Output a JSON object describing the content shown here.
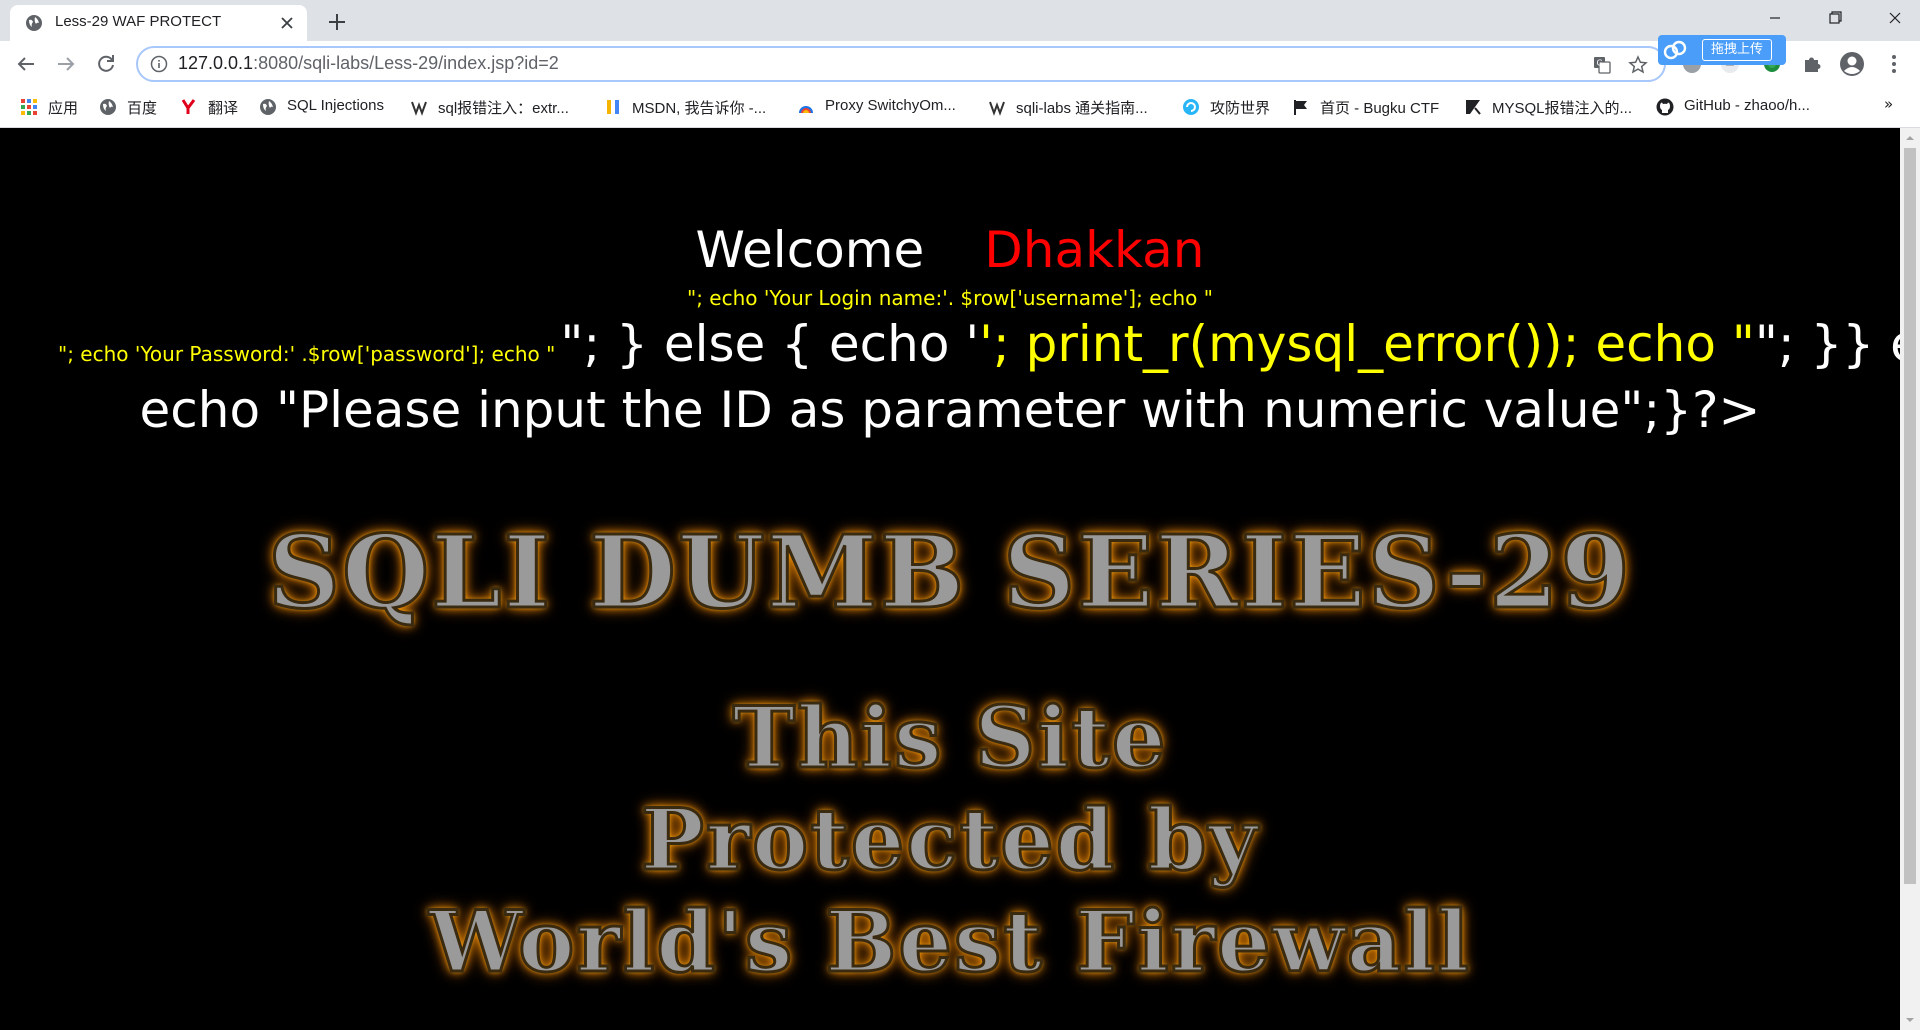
{
  "browser": {
    "tab_title": "Less-29 WAF PROTECT",
    "url_host": "127.0.0.1",
    "url_path": ":8080/sqli-labs/Less-29/index.jsp?id=2",
    "upload_badge_label": "拖拽上传",
    "bookmarks": [
      {
        "label": "应用",
        "icon": "apps-grid-icon"
      },
      {
        "label": "百度",
        "icon": "globe-icon"
      },
      {
        "label": "翻译",
        "icon": "youdao-icon"
      },
      {
        "label": "SQL Injections",
        "icon": "globe-icon"
      },
      {
        "label": "sql报错注入：extr...",
        "icon": "bookmark-site-icon"
      },
      {
        "label": "MSDN, 我告诉你 -...",
        "icon": "msdn-icon"
      },
      {
        "label": "Proxy SwitchyOm...",
        "icon": "switchyomega-icon"
      },
      {
        "label": "sqli-labs 通关指南...",
        "icon": "bookmark-site-icon"
      },
      {
        "label": "攻防世界",
        "icon": "adworld-icon"
      },
      {
        "label": "首页 - Bugku CTF",
        "icon": "flag-icon"
      },
      {
        "label": "MYSQL报错注入的...",
        "icon": "bookmark-site-icon"
      },
      {
        "label": "GitHub - zhaoo/h...",
        "icon": "github-icon"
      }
    ],
    "bookmarks_overflow": "»"
  },
  "page": {
    "welcome": "Welcome",
    "username": "Dhakkan",
    "login_line": "\"; echo 'Your Login name:'. $row['username']; echo \"",
    "password_line": "\"; echo 'Your Password:' .$row['password']; echo \"",
    "code_part1": "\"; } else { echo '",
    "code_part2": "'; print_r(mysql_error()); echo \"",
    "code_part3": "\"; }} else {",
    "code_line2": "echo \"Please input the ID as parameter with numeric value\";}?>",
    "series_title": "SQLI DUMB SERIES-29",
    "protect_line1": "This Site",
    "protect_line2": "Protected by",
    "protect_line3": "World's Best Firewall"
  },
  "colors": {
    "page_background": "#000000",
    "username_color": "#ff0000",
    "code_yellow": "#ffff00",
    "code_white": "#ffffff",
    "glow_orange": "#ff9a00"
  }
}
